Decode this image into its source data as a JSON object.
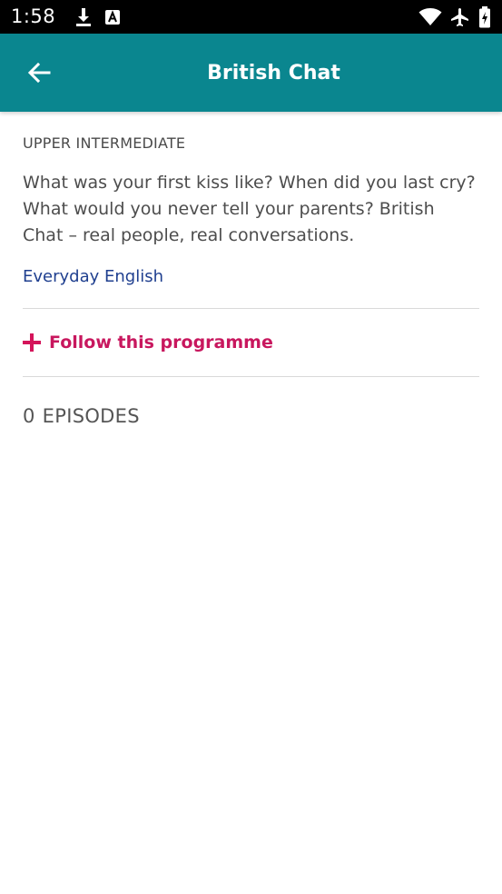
{
  "status_bar": {
    "time": "1:58",
    "left_icons": [
      "download-icon",
      "font-a-icon"
    ],
    "right_icons": [
      "wifi-icon",
      "airplane-mode-icon",
      "battery-icon"
    ]
  },
  "app_bar": {
    "title": "British Chat",
    "background_color": "#0a868f"
  },
  "programme": {
    "level": "UPPER INTERMEDIATE",
    "description": "What was your first kiss like? When did you last cry? What would you never tell your parents? British Chat – real people, real conversations.",
    "category": "Everyday English",
    "follow_label": "Follow this programme",
    "episode_count": "0",
    "episodes_label": "EPISODES"
  },
  "colors": {
    "accent": "#c8175e",
    "link": "#1f3f8f"
  }
}
